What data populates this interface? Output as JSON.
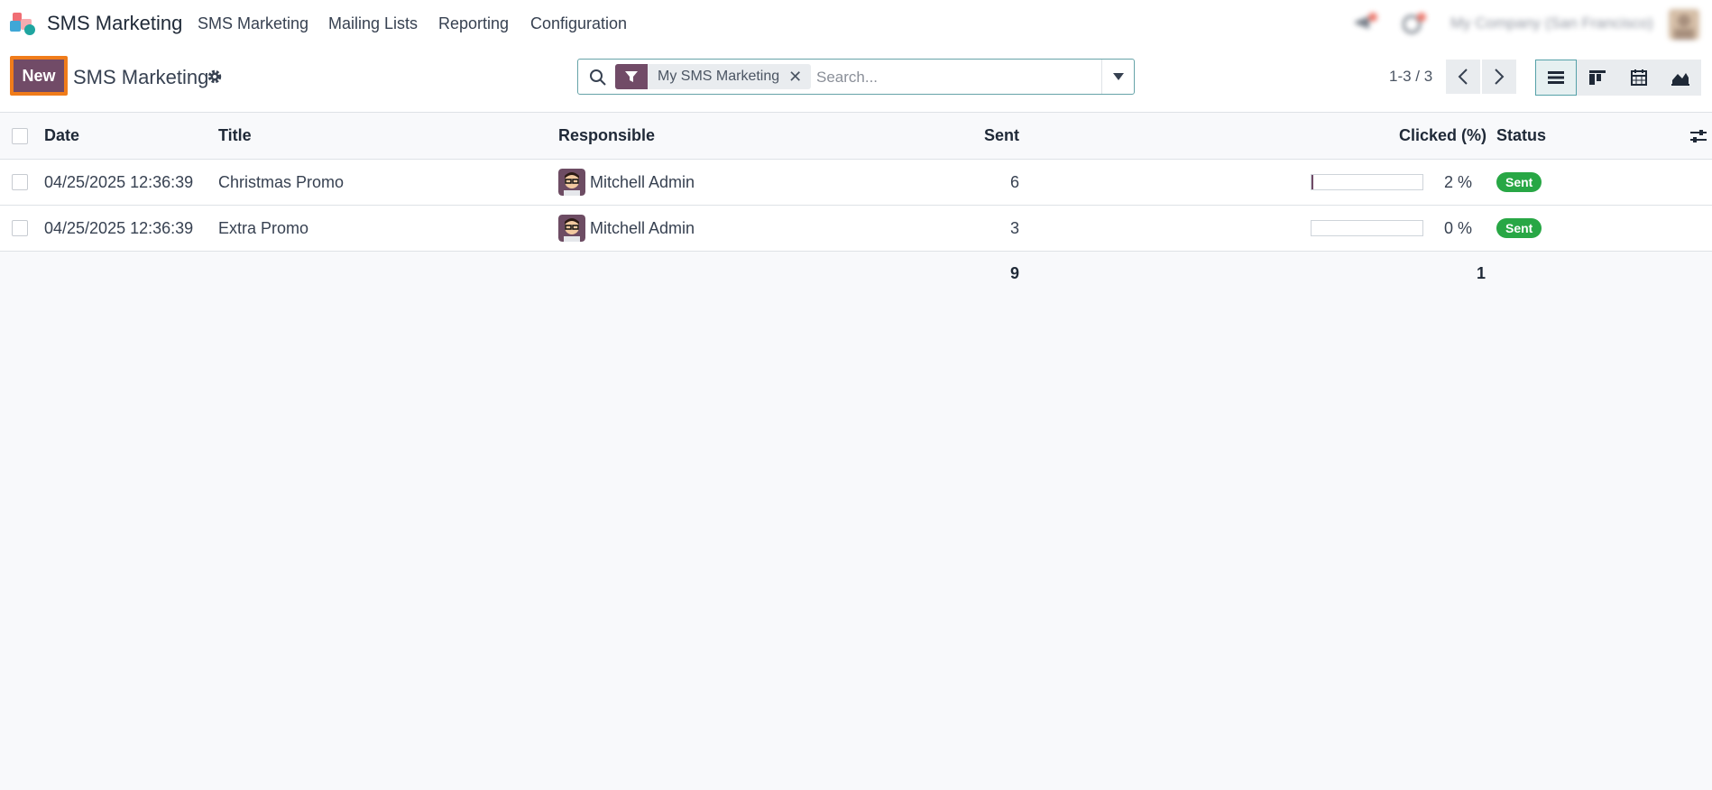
{
  "navbar": {
    "app_name": "SMS Marketing",
    "menu": [
      "SMS Marketing",
      "Mailing Lists",
      "Reporting",
      "Configuration"
    ],
    "company": "My Company (San Francisco)"
  },
  "control": {
    "new_label": "New",
    "title": "SMS Marketing",
    "search": {
      "facet": "My SMS Marketing",
      "placeholder": "Search..."
    },
    "pager": "1-3 / 3"
  },
  "table": {
    "columns": {
      "date": "Date",
      "title": "Title",
      "responsible": "Responsible",
      "sent": "Sent",
      "clicked": "Clicked (%)",
      "status": "Status"
    },
    "rows": [
      {
        "date": "04/25/2025 12:36:39",
        "title": "Christmas Promo",
        "responsible": "Mitchell Admin",
        "sent": "6",
        "clicked": "2 %",
        "clicked_value": 2,
        "status": "Sent"
      },
      {
        "date": "04/25/2025 12:36:39",
        "title": "Extra Promo",
        "responsible": "Mitchell Admin",
        "sent": "3",
        "clicked": "0 %",
        "clicked_value": 0,
        "status": "Sent"
      }
    ],
    "totals": {
      "sent": "9",
      "clicked": "1"
    }
  },
  "colors": {
    "brand": "#714b67",
    "highlight": "#f07c1a",
    "status_sent": "#28a745",
    "active_view": "#55a1a8"
  }
}
